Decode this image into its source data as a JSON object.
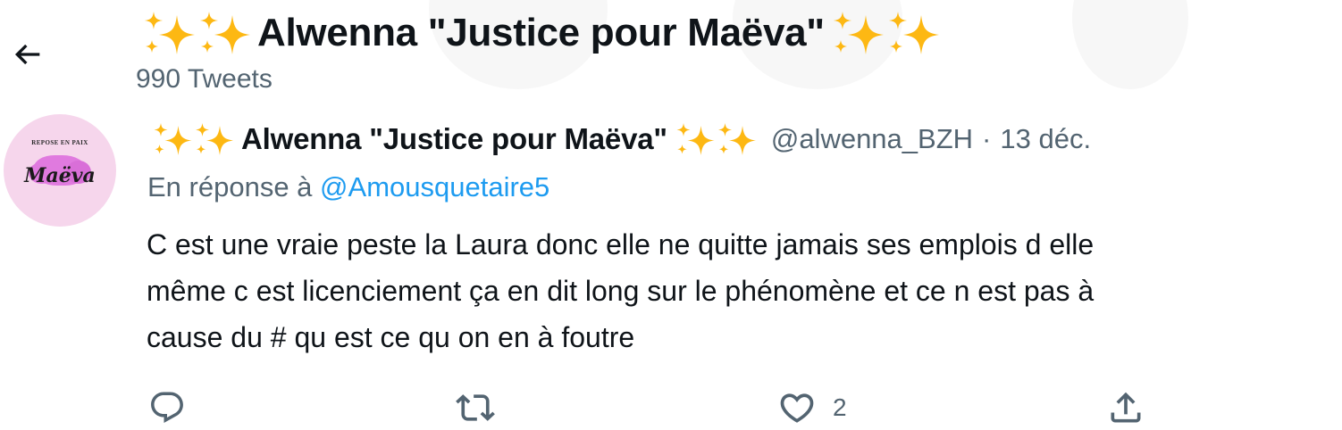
{
  "header": {
    "title": "Alwenna \"Justice pour Maëva\"",
    "tweet_count": "990 Tweets"
  },
  "avatar": {
    "top_text": "REPOSE EN PAIX",
    "name_text": "Maëva"
  },
  "tweet": {
    "author": "Alwenna \"Justice pour Maëva\"",
    "handle": "@alwenna_BZH",
    "separator": "·",
    "date": "13 déc.",
    "reply_prefix": "En réponse à",
    "reply_to": "@Amousquetaire5",
    "text_lines": [
      "C est une vraie peste la Laura donc elle ne quitte jamais ses emplois d elle",
      "même c est licenciement ça en dit long sur le phénomène et ce n est pas à",
      "cause du # qu est ce qu on en à foutre"
    ]
  },
  "actions": {
    "like_count": "2"
  },
  "colors": {
    "accent": "#1d9bf0",
    "secondary_text": "#536471",
    "sparkle": "#fdb813",
    "avatar_bg": "#f6d6ec"
  },
  "icons": [
    "back-arrow-icon",
    "sparkles-icon",
    "reply-icon",
    "retweet-icon",
    "like-icon",
    "share-icon"
  ]
}
